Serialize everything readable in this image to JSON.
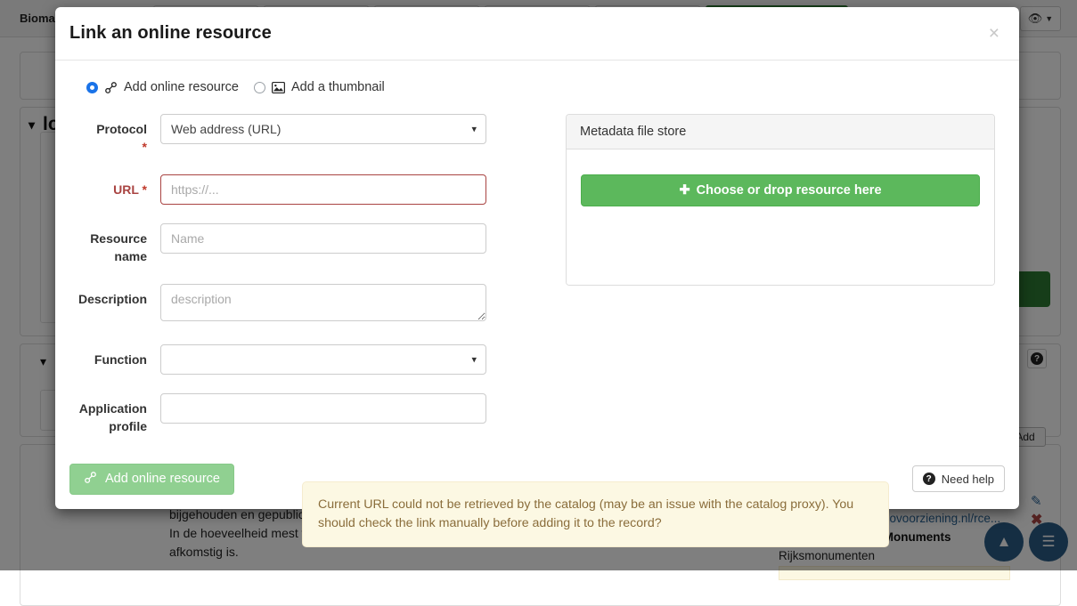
{
  "background": {
    "brand": "Bioma",
    "eye_icon": "eye-icon",
    "caret_icon": "caret-down-icon",
    "section_title": "lo",
    "chevron_icon": "chevron-down-icon",
    "add_button_label": "Add",
    "help_icon": "question-mark-icon",
    "description_text": "bijgehouden en gepubliceerd. Deze gegevens worden per gemeenten weergeven. In de hoeveelheid mest wordt onderscheid gemaakt per type vee waarvan de mest afkomstig is.",
    "resource_link": "http://services.rce.geovoorziening.nl/rce...",
    "resource_name": "rce:NationalListedMonuments",
    "resource_subtitle": "Rijksmonumenten",
    "edit_icon": "pencil-icon",
    "delete_icon": "red-x-icon",
    "fab_up_icon": "chevron-up-icon",
    "fab_menu_icon": "hamburger-menu-icon"
  },
  "modal": {
    "title": "Link an online resource",
    "close_icon": "close-icon",
    "mode_options": [
      {
        "label": "Add online resource",
        "icon": "link-icon",
        "selected": true
      },
      {
        "label": "Add a thumbnail",
        "icon": "image-icon",
        "selected": false
      }
    ],
    "form": {
      "protocol": {
        "label": "Protocol",
        "required_marker": "*",
        "value": "Web address (URL)",
        "options": [
          "Web address (URL)"
        ],
        "caret_icon": "chevron-down-icon"
      },
      "url": {
        "label": "URL",
        "required_marker": "*",
        "value": "",
        "placeholder": "https://...",
        "error": true
      },
      "resource_name": {
        "label": "Resource name",
        "value": "",
        "placeholder": "Name"
      },
      "description": {
        "label": "Description",
        "value": "",
        "placeholder": "description"
      },
      "function": {
        "label": "Function",
        "value": "",
        "options": [
          ""
        ],
        "caret_icon": "chevron-down-icon"
      },
      "application_profile": {
        "label": "Application profile",
        "value": "",
        "placeholder": ""
      }
    },
    "file_store": {
      "header": "Metadata file store",
      "drop_button_label": "Choose or drop resource here",
      "drop_button_icon": "plus-icon"
    },
    "alert": {
      "text": "Current URL could not be retrieved by the catalog (may be an issue with the catalog proxy). You should check the link manually before adding it to the record?"
    },
    "footer": {
      "submit_label": "Add online resource",
      "submit_icon": "link-icon",
      "help_label": "Need help",
      "help_icon": "question-mark-icon"
    }
  },
  "colors": {
    "accent_green": "#5cb85c",
    "submit_green": "#90d091",
    "alert_bg": "#fcf8e3",
    "alert_text": "#8a6d3b",
    "error_red": "#a94442",
    "radio_blue": "#1a73e8",
    "fab_blue": "#2a5d86",
    "bg_dark_green": "#2d7a33"
  }
}
